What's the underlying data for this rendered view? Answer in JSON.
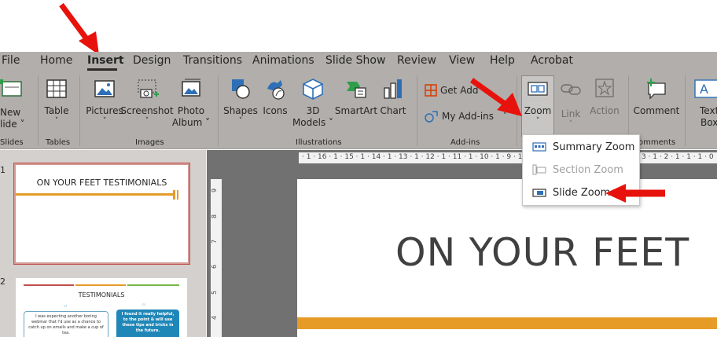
{
  "menu": {
    "tabs": [
      "File",
      "Home",
      "Insert",
      "Design",
      "Transitions",
      "Animations",
      "Slide Show",
      "Review",
      "View",
      "Help",
      "Acrobat"
    ],
    "active": "Insert"
  },
  "ribbon": {
    "slides": {
      "new_slide_line1": "New",
      "new_slide_line2": "lide",
      "group": "Slides"
    },
    "tables": {
      "table": "Table",
      "group": "Tables"
    },
    "images": {
      "pictures": "Pictures",
      "screenshot": "Screenshot",
      "photo_album_line1": "Photo",
      "photo_album_line2": "Album",
      "group": "Images"
    },
    "illustrations": {
      "shapes": "Shapes",
      "icons": "Icons",
      "models_line1": "3D",
      "models_line2": "Models",
      "smartart": "SmartArt",
      "chart": "Chart",
      "group": "Illustrations"
    },
    "addins": {
      "get_addins": "Get Add",
      "my_addins": "My Add-ins",
      "group": "Add-ins"
    },
    "links": {
      "zoom": "Zoom",
      "link": "Link",
      "action": "Action"
    },
    "comments": {
      "comment": "Comment",
      "group": "omments"
    },
    "text": {
      "textbox_line1": "Text",
      "textbox_line2": "Box"
    }
  },
  "zoom_menu": {
    "items": [
      {
        "label": "Summary Zoom",
        "enabled": true
      },
      {
        "label": "Section Zoom",
        "enabled": false
      },
      {
        "label": "Slide Zoom",
        "enabled": true
      }
    ]
  },
  "thumbnails": {
    "slide1": {
      "number": "1",
      "title": "ON YOUR FEET TESTIMONIALS"
    },
    "slide2": {
      "number": "2",
      "title": "TESTIMONIALS",
      "quote_left": "I was expecting another boring webinar that I'd use as a chance to catch up on emails and make a cup of tea.",
      "quote_right": "I found it really helpful, to the point & will use these tips and tricks in the future."
    }
  },
  "ruler": {
    "horizontal": "· 1 · 16 · 1 · 15 · 1 · 14 · 1 · 13 · 1 · 12 · 1 · 11 · 1 · 10 · 1 · 9 · 1 · 8",
    "horizontal_right": "3 · 1 · 2 · 1 · 1 · 1 · 0",
    "vertical": [
      "9",
      "8",
      "7",
      "6",
      "5",
      "4"
    ]
  },
  "slide": {
    "title": "ON YOUR FEET"
  },
  "colors": {
    "accent_orange": "#e69b27",
    "arrow_red": "#e8120c",
    "ribbon_gray": "#b1aeab"
  }
}
